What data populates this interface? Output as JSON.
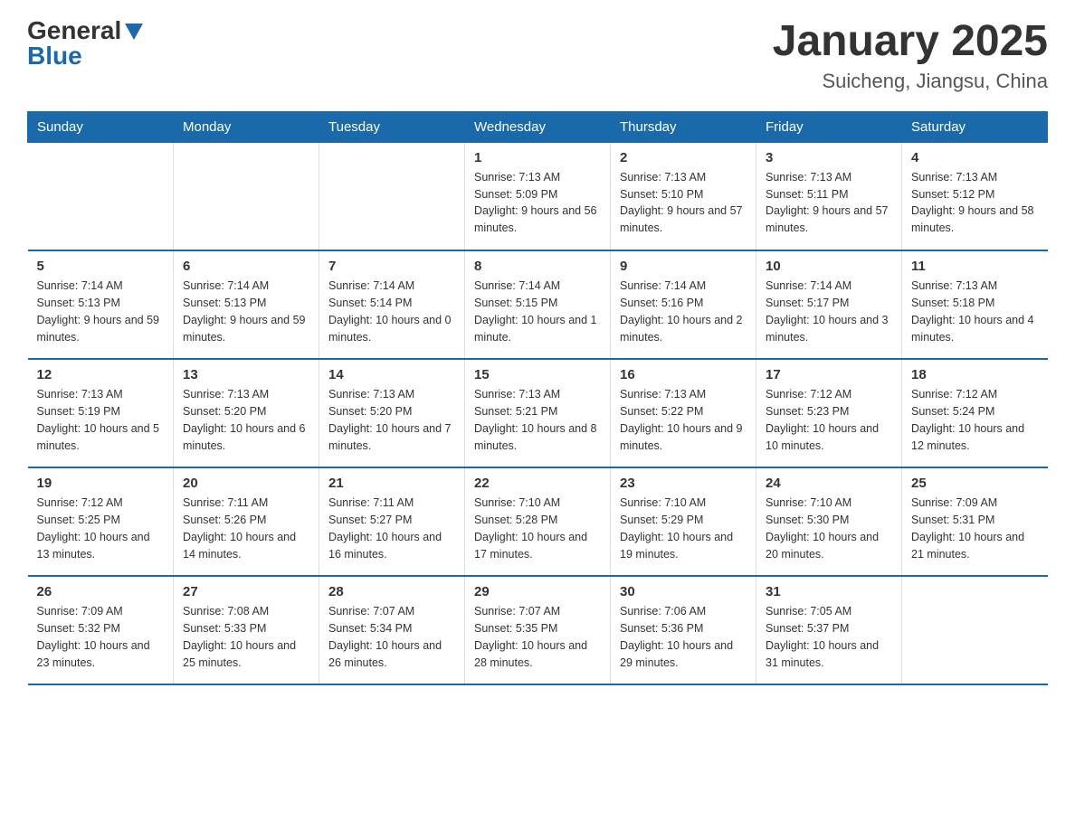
{
  "header": {
    "logo_text": "General",
    "logo_blue": "Blue",
    "title": "January 2025",
    "subtitle": "Suicheng, Jiangsu, China"
  },
  "days_of_week": [
    "Sunday",
    "Monday",
    "Tuesday",
    "Wednesday",
    "Thursday",
    "Friday",
    "Saturday"
  ],
  "weeks": [
    [
      {
        "day": "",
        "info": ""
      },
      {
        "day": "",
        "info": ""
      },
      {
        "day": "",
        "info": ""
      },
      {
        "day": "1",
        "info": "Sunrise: 7:13 AM\nSunset: 5:09 PM\nDaylight: 9 hours\nand 56 minutes."
      },
      {
        "day": "2",
        "info": "Sunrise: 7:13 AM\nSunset: 5:10 PM\nDaylight: 9 hours\nand 57 minutes."
      },
      {
        "day": "3",
        "info": "Sunrise: 7:13 AM\nSunset: 5:11 PM\nDaylight: 9 hours\nand 57 minutes."
      },
      {
        "day": "4",
        "info": "Sunrise: 7:13 AM\nSunset: 5:12 PM\nDaylight: 9 hours\nand 58 minutes."
      }
    ],
    [
      {
        "day": "5",
        "info": "Sunrise: 7:14 AM\nSunset: 5:13 PM\nDaylight: 9 hours\nand 59 minutes."
      },
      {
        "day": "6",
        "info": "Sunrise: 7:14 AM\nSunset: 5:13 PM\nDaylight: 9 hours\nand 59 minutes."
      },
      {
        "day": "7",
        "info": "Sunrise: 7:14 AM\nSunset: 5:14 PM\nDaylight: 10 hours\nand 0 minutes."
      },
      {
        "day": "8",
        "info": "Sunrise: 7:14 AM\nSunset: 5:15 PM\nDaylight: 10 hours\nand 1 minute."
      },
      {
        "day": "9",
        "info": "Sunrise: 7:14 AM\nSunset: 5:16 PM\nDaylight: 10 hours\nand 2 minutes."
      },
      {
        "day": "10",
        "info": "Sunrise: 7:14 AM\nSunset: 5:17 PM\nDaylight: 10 hours\nand 3 minutes."
      },
      {
        "day": "11",
        "info": "Sunrise: 7:13 AM\nSunset: 5:18 PM\nDaylight: 10 hours\nand 4 minutes."
      }
    ],
    [
      {
        "day": "12",
        "info": "Sunrise: 7:13 AM\nSunset: 5:19 PM\nDaylight: 10 hours\nand 5 minutes."
      },
      {
        "day": "13",
        "info": "Sunrise: 7:13 AM\nSunset: 5:20 PM\nDaylight: 10 hours\nand 6 minutes."
      },
      {
        "day": "14",
        "info": "Sunrise: 7:13 AM\nSunset: 5:20 PM\nDaylight: 10 hours\nand 7 minutes."
      },
      {
        "day": "15",
        "info": "Sunrise: 7:13 AM\nSunset: 5:21 PM\nDaylight: 10 hours\nand 8 minutes."
      },
      {
        "day": "16",
        "info": "Sunrise: 7:13 AM\nSunset: 5:22 PM\nDaylight: 10 hours\nand 9 minutes."
      },
      {
        "day": "17",
        "info": "Sunrise: 7:12 AM\nSunset: 5:23 PM\nDaylight: 10 hours\nand 10 minutes."
      },
      {
        "day": "18",
        "info": "Sunrise: 7:12 AM\nSunset: 5:24 PM\nDaylight: 10 hours\nand 12 minutes."
      }
    ],
    [
      {
        "day": "19",
        "info": "Sunrise: 7:12 AM\nSunset: 5:25 PM\nDaylight: 10 hours\nand 13 minutes."
      },
      {
        "day": "20",
        "info": "Sunrise: 7:11 AM\nSunset: 5:26 PM\nDaylight: 10 hours\nand 14 minutes."
      },
      {
        "day": "21",
        "info": "Sunrise: 7:11 AM\nSunset: 5:27 PM\nDaylight: 10 hours\nand 16 minutes."
      },
      {
        "day": "22",
        "info": "Sunrise: 7:10 AM\nSunset: 5:28 PM\nDaylight: 10 hours\nand 17 minutes."
      },
      {
        "day": "23",
        "info": "Sunrise: 7:10 AM\nSunset: 5:29 PM\nDaylight: 10 hours\nand 19 minutes."
      },
      {
        "day": "24",
        "info": "Sunrise: 7:10 AM\nSunset: 5:30 PM\nDaylight: 10 hours\nand 20 minutes."
      },
      {
        "day": "25",
        "info": "Sunrise: 7:09 AM\nSunset: 5:31 PM\nDaylight: 10 hours\nand 21 minutes."
      }
    ],
    [
      {
        "day": "26",
        "info": "Sunrise: 7:09 AM\nSunset: 5:32 PM\nDaylight: 10 hours\nand 23 minutes."
      },
      {
        "day": "27",
        "info": "Sunrise: 7:08 AM\nSunset: 5:33 PM\nDaylight: 10 hours\nand 25 minutes."
      },
      {
        "day": "28",
        "info": "Sunrise: 7:07 AM\nSunset: 5:34 PM\nDaylight: 10 hours\nand 26 minutes."
      },
      {
        "day": "29",
        "info": "Sunrise: 7:07 AM\nSunset: 5:35 PM\nDaylight: 10 hours\nand 28 minutes."
      },
      {
        "day": "30",
        "info": "Sunrise: 7:06 AM\nSunset: 5:36 PM\nDaylight: 10 hours\nand 29 minutes."
      },
      {
        "day": "31",
        "info": "Sunrise: 7:05 AM\nSunset: 5:37 PM\nDaylight: 10 hours\nand 31 minutes."
      },
      {
        "day": "",
        "info": ""
      }
    ]
  ]
}
